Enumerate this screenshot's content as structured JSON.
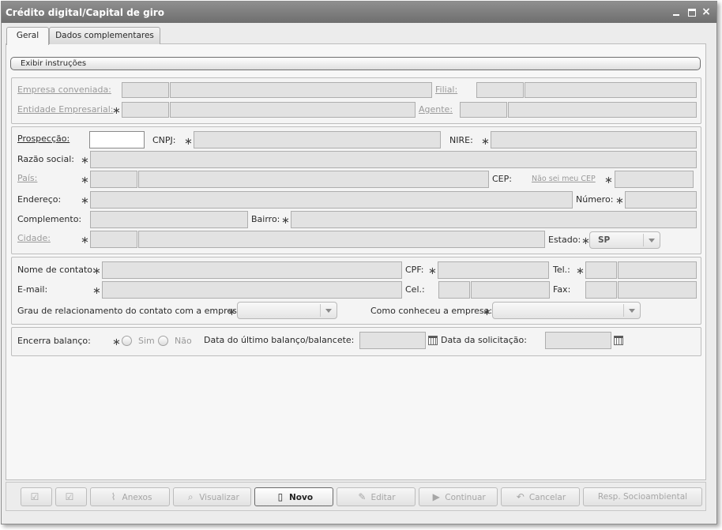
{
  "window": {
    "title": "Crédito digital/Capital de giro",
    "close_glyph": "×"
  },
  "tabs": [
    {
      "label": "Geral",
      "active": true
    },
    {
      "label": "Dados complementares",
      "active": false
    }
  ],
  "instructions_button": "Exibir instruções",
  "group1": {
    "empresa_label": "Empresa conveniada:",
    "filial_label": "Filial:",
    "entidade_label": "Entidade Empresarial:",
    "agente_label": "Agente:"
  },
  "group2": {
    "prospeccao_label": "Prospecção:",
    "cnpj_label": "CNPJ:",
    "nire_label": "NIRE:",
    "razao_label": "Razão social:",
    "pais_label": "País:",
    "cep_label": "CEP:",
    "nao_sei_cep": "Não sei meu CEP",
    "endereco_label": "Endereço:",
    "numero_label": "Número:",
    "complemento_label": "Complemento:",
    "bairro_label": "Bairro:",
    "cidade_label": "Cidade:",
    "estado_label": "Estado:",
    "estado_value": "SP"
  },
  "group3": {
    "nome_contato_label": "Nome de contato:",
    "cpf_label": "CPF:",
    "tel_label": "Tel.:",
    "email_label": "E-mail:",
    "cel_label": "Cel.:",
    "fax_label": "Fax:",
    "grau_label": "Grau de relacionamento do contato com a empresa:",
    "como_label": "Como conheceu a empresa:"
  },
  "group4": {
    "encerra_label": "Encerra balanço:",
    "sim_label": "Sim",
    "nao_label": "Não",
    "ultimo_balanco_label": "Data do último balanço/balancete:",
    "data_solicitacao_label": "Data da solicitação:"
  },
  "required_mark": "∗",
  "buttons": {
    "anexos": "Anexos",
    "visualizar": "Visualizar",
    "novo": "Novo",
    "editar": "Editar",
    "continuar": "Continuar",
    "cancelar": "Cancelar",
    "resp": "Resp. Socioambiental"
  },
  "icons": {
    "check1": "check-edit-icon",
    "check2": "check-edit-icon",
    "anexos": "paperclip-icon",
    "visualizar": "magnifier-icon",
    "novo": "new-document-icon",
    "editar": "pencil-icon",
    "continuar": "play-icon",
    "cancelar": "undo-arrow-icon",
    "calendar": "calendar-icon"
  }
}
